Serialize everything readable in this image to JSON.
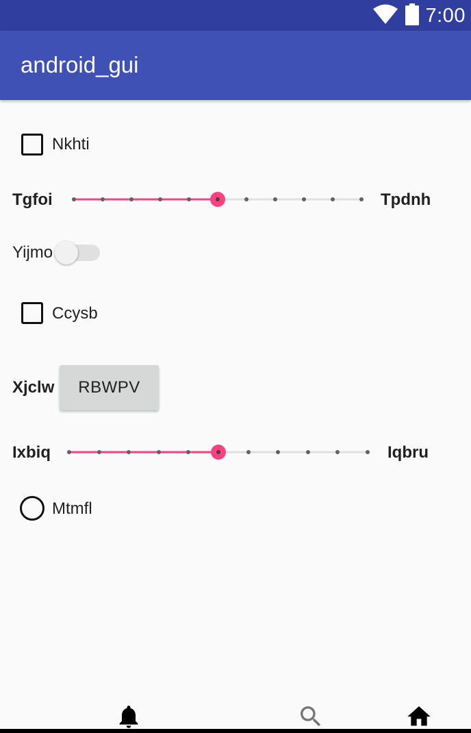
{
  "status_bar": {
    "time": "7:00",
    "icons": [
      "wifi-icon",
      "battery-icon"
    ],
    "color": "#303f9f"
  },
  "app_bar": {
    "title": "android_gui",
    "color": "#3f51b5"
  },
  "controls": {
    "checkbox1": {
      "label": "Nkhti",
      "checked": false
    },
    "slider1": {
      "left_label": "Tgfoi",
      "right_label": "Tpdnh",
      "value": 5,
      "max": 10
    },
    "switch1": {
      "label": "Yijmo",
      "on": false
    },
    "checkbox2": {
      "label": "Ccysb",
      "checked": false
    },
    "button_row": {
      "label": "Xjclw",
      "button_label": "RBWPV"
    },
    "slider2": {
      "left_label": "Ixbiq",
      "right_label": "Iqbru",
      "value": 5,
      "max": 10
    },
    "radio1": {
      "label": "Mtmfl",
      "selected": false
    }
  },
  "accent_color": "#ff4081",
  "bottom_nav": {
    "items": [
      "bell-icon",
      "search-icon",
      "home-icon"
    ]
  }
}
